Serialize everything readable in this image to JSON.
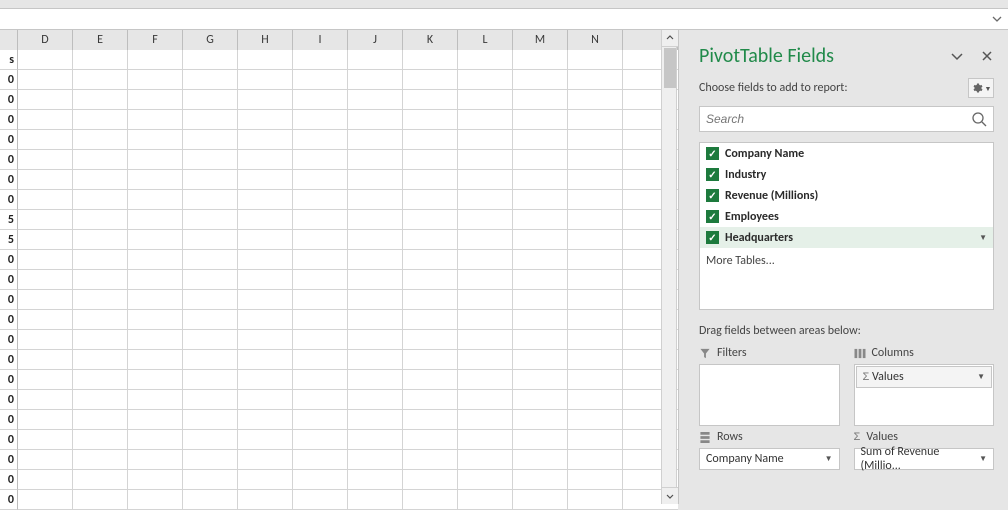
{
  "formula_bar": {
    "value": ""
  },
  "columns": [
    "D",
    "E",
    "F",
    "G",
    "H",
    "I",
    "J",
    "K",
    "L",
    "M",
    "N"
  ],
  "first_col_values": [
    "s",
    "0",
    "0",
    "0",
    "0",
    "0",
    "0",
    "0",
    "5",
    "5",
    "0",
    "0",
    "0",
    "0",
    "0",
    "0",
    "0",
    "0",
    "0",
    "0",
    "0",
    "0",
    "0"
  ],
  "panel": {
    "title": "PivotTable Fields",
    "subtitle": "Choose fields to add to report:",
    "search_placeholder": "Search",
    "fields": [
      {
        "label": "Company Name",
        "checked": true
      },
      {
        "label": "Industry",
        "checked": true
      },
      {
        "label": "Revenue (Millions)",
        "checked": true
      },
      {
        "label": "Employees",
        "checked": true
      },
      {
        "label": "Headquarters",
        "checked": true,
        "hover": true
      }
    ],
    "more_tables": "More Tables...",
    "drag_label": "Drag fields between areas below:",
    "areas": {
      "filters_label": "Filters",
      "columns_label": "Columns",
      "rows_label": "Rows",
      "values_label": "Values",
      "columns_item": "Values",
      "rows_item": "Company Name",
      "values_item": "Sum of Revenue (Millio..."
    }
  }
}
